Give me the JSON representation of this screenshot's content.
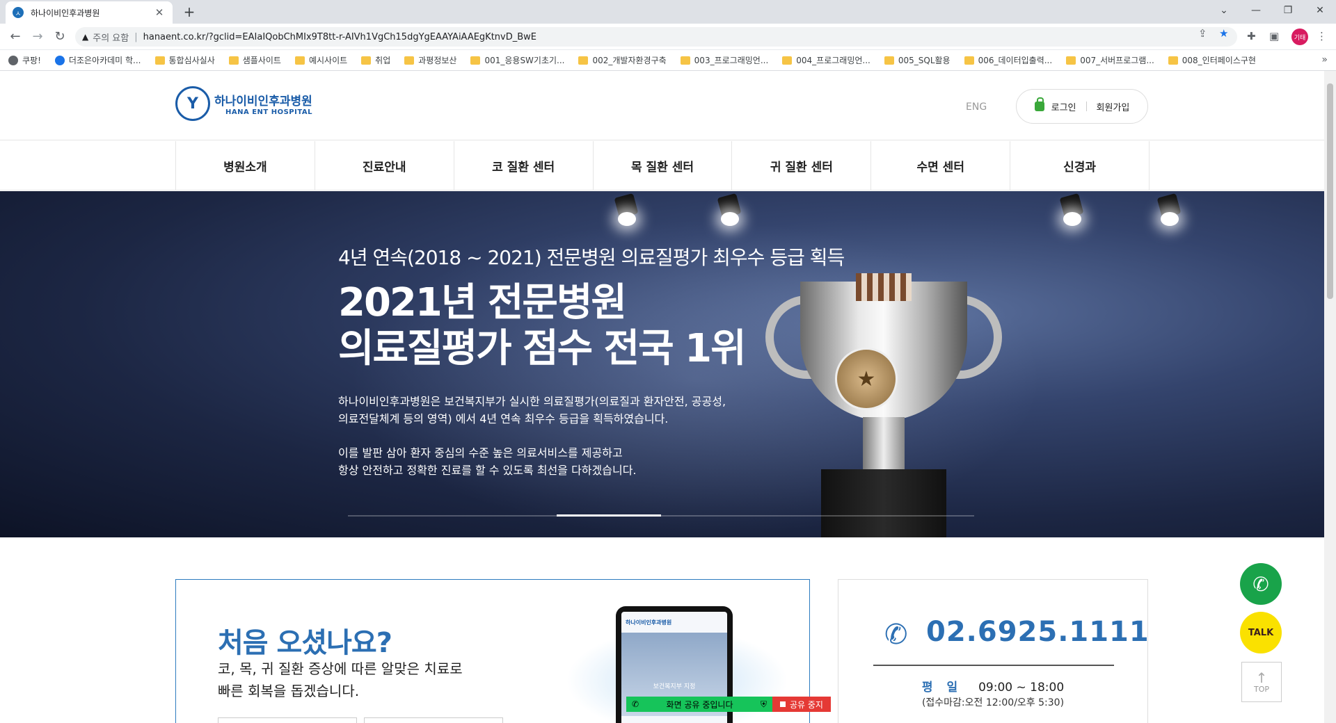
{
  "browser": {
    "tab_title": "하나이비인후과병원",
    "tab_close": "✕",
    "new_tab": "+",
    "security_warning": "주의 요함",
    "url": "hanaent.co.kr/?gclid=EAIaIQobChMIx9T8tt-r-AIVh1VgCh15dgYgEAAYAiAAEgKtnvD_BwE",
    "profile_label": "기태",
    "bookmarks": [
      "쿠팡!",
      "더조은아카데미 학...",
      "통합심사실사",
      "샘플사이트",
      "예시사이트",
      "취업",
      "과평정보산",
      "001_응용SW기초기...",
      "002_개발자환경구축",
      "003_프로그래밍언...",
      "004_프로그래밍언...",
      "005_SQL활용",
      "006_데이터입출력...",
      "007_서버프로그램...",
      "008_인터페이스구현"
    ],
    "bookmarks_more": "»"
  },
  "header": {
    "logo_ko": "하나이비인후과병원",
    "logo_en": "HANA ENT HOSPITAL",
    "lang": "ENG",
    "login": "로그인",
    "signup": "회원가입"
  },
  "gnb": [
    "병원소개",
    "진료안내",
    "코 질환 센터",
    "목 질환 센터",
    "귀 질환 센터",
    "수면 센터",
    "신경과"
  ],
  "hero": {
    "subtitle": "4년 연속(2018 ~ 2021) 전문병원 의료질평가 최우수 등급 획득",
    "title_line1": "2021년 전문병원",
    "title_line2": "의료질평가 점수 전국 1위",
    "desc1_line1": "하나이비인후과병원은 보건복지부가 실시한 의료질평가(의료질과 환자안전, 공공성,",
    "desc1_line2": "의료전달체계 등의 영역) 에서 4년 연속 최우수 등급을 획득하였습니다.",
    "desc2_line1": "이를 발판 삼아 환자 중심의 수준 높은 의료서비스를 제공하고",
    "desc2_line2": "항상 안전하고 정확한 진료를 할 수 있도록 최선을 다하겠습니다."
  },
  "welcome": {
    "title": "처음 오셨나요?",
    "line1": "코, 목, 귀 질환 증상에 따른 알맞은 치료로",
    "line2": "빠른 회복을 돕겠습니다.",
    "phone_logo": "하나이비인후과병원",
    "phone_text": "보건복지부 지정"
  },
  "contact": {
    "phone": "02.6925.1111",
    "hours_label": "평일",
    "hours": "09:00 ~ 18:00",
    "note": "(접수마감:오전 12:00/오후 5:30)"
  },
  "share": {
    "status": "화면 공유 중입니다",
    "stop": "공유 중지"
  },
  "floating": {
    "talk": "TALK",
    "top": "TOP"
  }
}
